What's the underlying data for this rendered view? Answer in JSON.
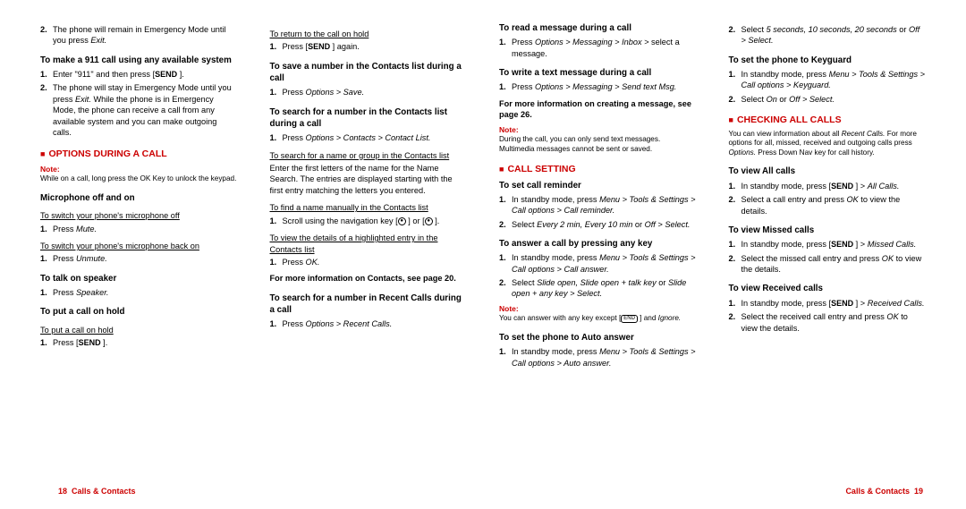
{
  "col1": {
    "li_a": "The phone will remain in Emergency Mode until you press ",
    "li_a_it": "Exit.",
    "h1": "To make a 911 call using any available system",
    "li1": "Enter \"911\" and then press [",
    "li2": "The phone will stay in Emergency Mode until you press ",
    "li2_it": "Exit.",
    "li2_b": " While the phone is in Emergency Mode, the phone can receive a call from any available system and you can make outgoing calls.",
    "sec1": "OPTIONS DURING A CALL",
    "note1": "Note:",
    "note1txt": "While on a call, long press the OK Key to unlock the keypad.",
    "h2": "Microphone off and on",
    "u1": "To switch your phone's microphone off",
    "u1li": "Press ",
    "u1it": "Mute.",
    "u2": "To switch your phone's microphone back on",
    "u2li": "Press ",
    "u2it": "Unmute.",
    "h3": "To talk on speaker",
    "h3li": "Press ",
    "h3it": "Speaker.",
    "h4": "To put a call on hold",
    "u3": "To put a call on hold",
    "h4li": "Press [",
    "send": "SEND",
    "closebr": " ]."
  },
  "col2": {
    "u1": "To return to the call on hold",
    "u1li": "Press [",
    "u1end": " ] again.",
    "h1": "To save a number in the Contacts list during a call",
    "h1li": "Press ",
    "h1it": "Options > Save.",
    "h2": "To search for a number in the Contacts list during a call",
    "h2li": "Press ",
    "h2it": "Options > Contacts > Contact List.",
    "u2": "To search for a name or group in the Contacts list",
    "p1": "Enter the first letters of the name for the Name Search. The entries are displayed starting with the first entry matching the letters you entered.",
    "u3": "To find a name manually in the Contacts list",
    "u3li": "Scroll using the navigation key [",
    "u3mid": " ] or [",
    "u3end": " ].",
    "u4": "To view the details of a highlighted entry in the Contacts list",
    "u4li": "Press ",
    "u4it": "OK.",
    "cross1": "For more information on Contacts, see page 20.",
    "h3": "To search for a number in Recent Calls during a call",
    "h3li": "Press ",
    "h3it": "Options > Recent Calls."
  },
  "col3": {
    "h1": "To read a message during a call",
    "h1li": "Press ",
    "h1it": "Options > Messaging > Inbox >",
    "h1end": " select a message.",
    "h2": "To write a text message during a call",
    "h2li": "Press ",
    "h2it": "Options > Messaging > Send text Msg.",
    "cross1": "For more information on creating a message, see page 26.",
    "note1": "Note:",
    "note1txt": "During the call, you can only send text messages. Multimedia messages cannot be sent or saved.",
    "sec1": "CALL SETTING",
    "h3": "To set call reminder",
    "h3li1": "In standby mode, press ",
    "h3li1it": "Menu > Tools & Settings > Call options > Call reminder.",
    "h3li2": "Select ",
    "h3li2it": "Every 2 min, Every 10 min ",
    "h3li2b": "or ",
    "h3li2it2": "Off > Select.",
    "h4": "To answer a call by pressing any key",
    "h4li1": "In standby mode, press ",
    "h4li1it": "Menu > Tools & Settings > Call options > Call answer.",
    "h4li2": "Select ",
    "h4li2it": "Slide open, Slide open + talk key ",
    "h4li2b": "or ",
    "h4li2it2": "Slide open + any key > Select.",
    "note2": "Note:",
    "note2a": "You can answer with any key except [",
    "note2c": " ] and ",
    "note2it": "Ignore.",
    "h5": "To set the phone to Auto answer",
    "h5li1": "In standby mode, press ",
    "h5li1it": "Menu > Tools & Settings > Call options > Auto answer."
  },
  "col4": {
    "li0": "Select ",
    "li0it": "5 seconds, 10 seconds, 20 seconds ",
    "li0b": "or ",
    "li0it2": "Off > Select.",
    "h1": "To set the phone to Keyguard",
    "h1li1": "In standby mode, press ",
    "h1li1it": "Menu > Tools & Settings > Call options > Keyguard.",
    "h1li2": "Select ",
    "h1li2it": "On ",
    "h1li2b": "or ",
    "h1li2it2": "Off > Select.",
    "sec1": "CHECKING ALL CALLS",
    "sec1p1a": "You can view information about all ",
    "sec1p1it": "Recent Calls.",
    "sec1p1b": " For more options for all, missed, received and outgoing calls press ",
    "sec1p1it2": "Options.",
    "sec1p1c": " Press Down Nav key for call history.",
    "h2": "To view All calls",
    "h2li1": "In standby mode, press [",
    "h2li1end": " ] > ",
    "h2li1it": "All Calls.",
    "h2li2a": "Select a call entry and press ",
    "h2li2it": "OK",
    "h2li2b": " to view the details.",
    "h3": "To view Missed calls",
    "h3li1": "In standby mode, press [",
    "h3li1end": " ] > ",
    "h3li1it": "Missed Calls.",
    "h3li2a": "Select the missed call entry and press ",
    "h3li2it": "OK",
    "h3li2b": " to view the details.",
    "h4": "To view Received calls",
    "h4li1": "In standby mode, press [",
    "h4li1end": " ] > ",
    "h4li1it": "Received Calls.",
    "h4li2a": "Select the received call entry and press ",
    "h4li2it": "OK",
    "h4li2b": " to view the details."
  },
  "footer": {
    "left_num": "18",
    "left_text": "Calls & Contacts",
    "right_text": "Calls & Contacts",
    "right_num": "19"
  },
  "keys": {
    "send": "SEND",
    "end": "END"
  }
}
